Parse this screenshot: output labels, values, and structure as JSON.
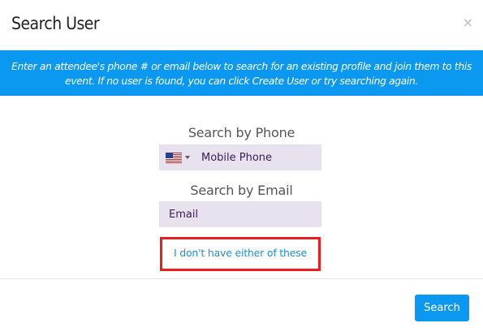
{
  "dialog": {
    "title": "Search User",
    "close_glyph": "×",
    "close_icon": "close-icon"
  },
  "banner": {
    "text": "Enter an attendee's phone # or email below to search for an existing profile and join them to this event. If no user is found, you can click Create User or try searching again.",
    "background_color": "#0b98f0"
  },
  "phone_section": {
    "label": "Search by Phone",
    "country_flag": "us-flag-icon",
    "input_value": "",
    "placeholder": "Mobile Phone"
  },
  "email_section": {
    "label": "Search by Email",
    "input_value": "",
    "placeholder": "Email"
  },
  "no_info_link": {
    "label": "I don't have either of these",
    "highlight_color": "#ee1c1c"
  },
  "footer": {
    "search_label": "Search",
    "button_color": "#0b98f0"
  }
}
